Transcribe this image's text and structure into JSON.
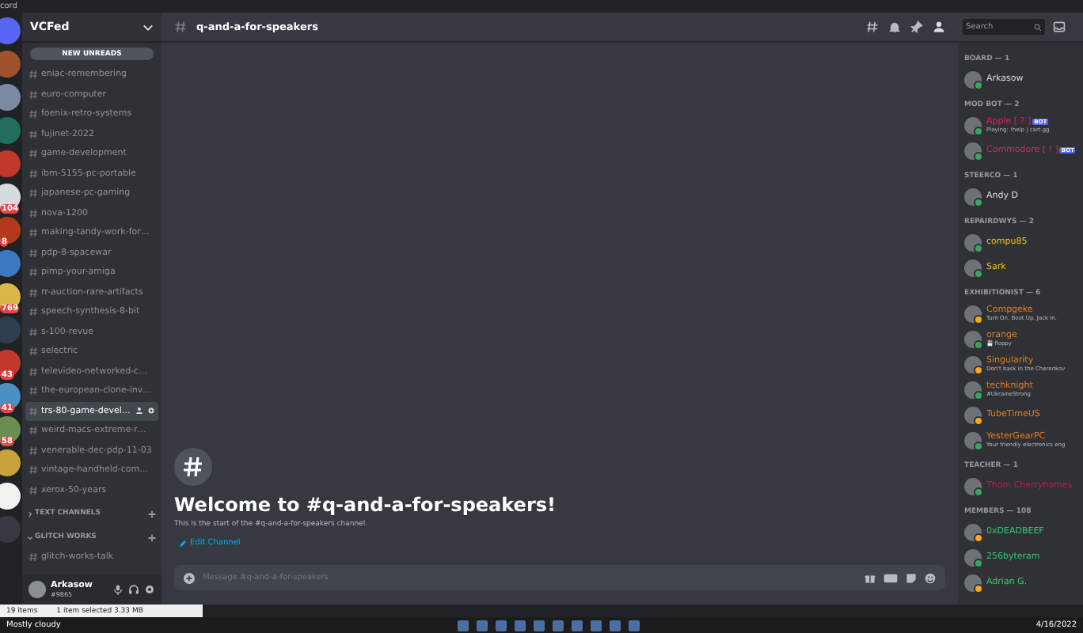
{
  "titlebar": {
    "title": "cord"
  },
  "servers": [
    {
      "color": "#5865f2"
    },
    {
      "color": "#a0522d"
    },
    {
      "color": "#7a8aa0"
    },
    {
      "color": "#1f6f5c"
    },
    {
      "color": "#c0392b"
    },
    {
      "color": "#d6dbe0",
      "badge": "104"
    },
    {
      "color": "#b4391c",
      "badge": "8"
    },
    {
      "color": "#3a7ac0"
    },
    {
      "color": "#d8b84a",
      "badge": "769"
    },
    {
      "color": "#2c3e50"
    },
    {
      "color": "#c0392b",
      "badge": "43"
    },
    {
      "color": "#4a90c0",
      "badge": "41"
    },
    {
      "color": "#6b8e4e",
      "badge": "58"
    },
    {
      "color": "#c9a43a"
    },
    {
      "color": "#f2f2f2"
    },
    {
      "color": "#36393f"
    }
  ],
  "sidebar": {
    "server_name": "VCFed",
    "new_unreads": "NEW UNREADS",
    "channels": [
      {
        "name": "eniac-remembering",
        "selected": false
      },
      {
        "name": "euro-computer",
        "selected": false
      },
      {
        "name": "foenix-retro-systems",
        "selected": false
      },
      {
        "name": "fujinet-2022",
        "selected": false
      },
      {
        "name": "game-development",
        "selected": false
      },
      {
        "name": "ibm-5155-pc-portable",
        "selected": false
      },
      {
        "name": "japanese-pc-gaming",
        "selected": false
      },
      {
        "name": "nova-1200",
        "selected": false
      },
      {
        "name": "making-tandy-work-for…",
        "selected": false
      },
      {
        "name": "pdp-8-spacewar",
        "selected": false
      },
      {
        "name": "pimp-your-amiga",
        "selected": false
      },
      {
        "name": "rr-auction-rare-artifacts",
        "selected": false
      },
      {
        "name": "speech-synthesis-8-bit",
        "selected": false
      },
      {
        "name": "s-100-revue",
        "selected": false
      },
      {
        "name": "selectric",
        "selected": false
      },
      {
        "name": "televideo-networked-c…",
        "selected": false
      },
      {
        "name": "the-european-clone-inv…",
        "selected": false
      },
      {
        "name": "trs-80-game-devel…",
        "selected": true
      },
      {
        "name": "weird-macs-extreme-r…",
        "selected": false
      },
      {
        "name": "venerable-dec-pdp-11-03",
        "selected": false
      },
      {
        "name": "vintage-handheld-com…",
        "selected": false
      },
      {
        "name": "xerox-50-years",
        "selected": false
      }
    ],
    "categories": [
      {
        "name": "TEXT CHANNELS",
        "expanded": false
      },
      {
        "name": "GLITCH WORKS",
        "expanded": true,
        "channels": [
          "glitch-works-talk"
        ]
      }
    ],
    "user": {
      "name": "Arkasow",
      "tag": "#9865"
    }
  },
  "chat": {
    "channel": "q-and-a-for-speakers",
    "welcome_title": "Welcome to #q-and-a-for-speakers!",
    "welcome_text": "This is the start of the #q-and-a-for-speakers channel.",
    "edit_link": "Edit Channel",
    "input_placeholder": "Message #q-and-a-for-speakers"
  },
  "members": {
    "search_placeholder": "Search",
    "groups": [
      {
        "title": "BOARD — 1",
        "members": [
          {
            "name": "Arkasow",
            "color": "#dcddde",
            "idle": false
          }
        ]
      },
      {
        "title": "MOD BOT — 2",
        "members": [
          {
            "name": "Apple [ ? ]",
            "color": "#e91e63",
            "idle": false,
            "activity": "Playing: !help | cart.gg",
            "bot": "BOT"
          },
          {
            "name": "Commodore [ ! ]",
            "color": "#e91e63",
            "idle": false,
            "bot": "BOT"
          }
        ]
      },
      {
        "title": "STEERCO — 1",
        "members": [
          {
            "name": "Andy D",
            "color": "#dcddde",
            "idle": false
          }
        ]
      },
      {
        "title": "REPAIRDWYS — 2",
        "members": [
          {
            "name": "compu85",
            "color": "#f1c40f",
            "idle": false
          },
          {
            "name": "Sark",
            "color": "#f1c40f",
            "idle": false
          }
        ]
      },
      {
        "title": "EXHIBITIONIST — 6",
        "members": [
          {
            "name": "Compgeke",
            "color": "#e67e22",
            "idle": true,
            "activity": "Turn On, Boot Up, Jack In."
          },
          {
            "name": "orange",
            "color": "#e67e22",
            "idle": false,
            "activity": "💾 floppy"
          },
          {
            "name": "Singularity",
            "color": "#e67e22",
            "idle": true,
            "activity": "Don't bask in the Cherenkov"
          },
          {
            "name": "techknight",
            "color": "#e67e22",
            "idle": false,
            "activity": "#UkraineStrong"
          },
          {
            "name": "TubeTimeUS",
            "color": "#e67e22",
            "idle": true
          },
          {
            "name": "YesterGearPC",
            "color": "#e67e22",
            "idle": false,
            "activity": "Your friendly electronics eng"
          }
        ]
      },
      {
        "title": "TEACHER — 1",
        "members": [
          {
            "name": "Thom Cherryhomes",
            "color": "#c2185b",
            "idle": false
          }
        ]
      },
      {
        "title": "MEMBERS — 108",
        "members": [
          {
            "name": "0xDEADBEEF",
            "color": "#2ecc71",
            "idle": true
          },
          {
            "name": "256byteram",
            "color": "#2ecc71",
            "idle": false
          },
          {
            "name": "Adrian G.",
            "color": "#2ecc71",
            "idle": true
          }
        ]
      }
    ]
  },
  "explorer_status": {
    "items": "19 items",
    "selection": "1 item selected  3.33 MB"
  },
  "taskbar": {
    "weather": "Mostly cloudy",
    "date": "4/16/2022"
  }
}
